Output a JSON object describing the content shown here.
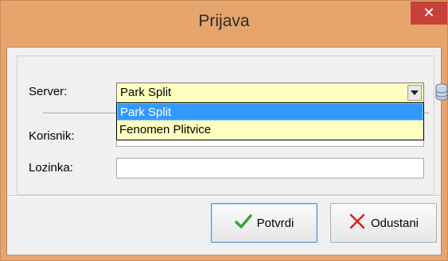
{
  "window": {
    "title": "Prijava",
    "close_glyph": "✕"
  },
  "form": {
    "server_label": "Server:",
    "server_value": "Park Split",
    "server_options": [
      "Park Split",
      "Fenomen Plitvice"
    ],
    "user_label": "Korisnik:",
    "user_value": "",
    "password_label": "Lozinka:",
    "password_value": ""
  },
  "buttons": {
    "confirm_label": "Potvrdi",
    "cancel_label": "Odustani"
  },
  "icons": {
    "close": "close-icon",
    "server_db": "database-icon",
    "confirm": "checkmark-icon",
    "cancel": "x-mark-icon"
  },
  "colors": {
    "titlebar": "#e6a56d",
    "close_button": "#c7403a",
    "combo_background": "#ffffc0",
    "selection": "#3399ff",
    "confirm_check": "#3aa33a",
    "cancel_x": "#d42020"
  }
}
